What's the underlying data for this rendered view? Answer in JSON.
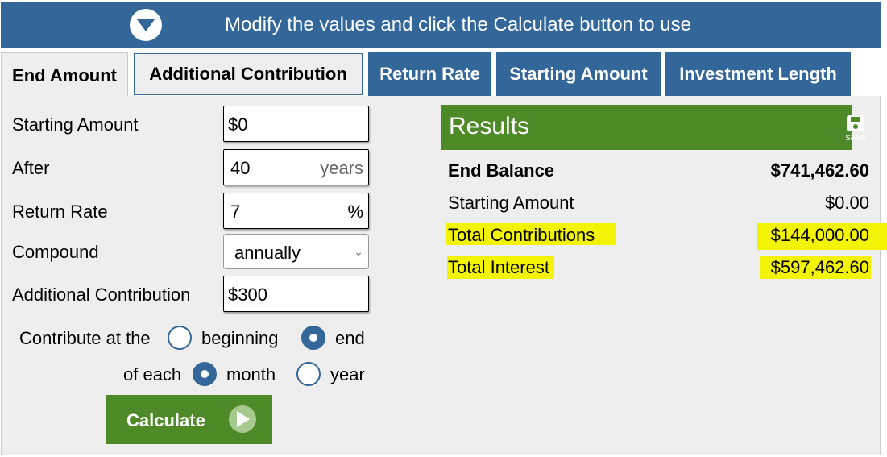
{
  "banner": {
    "text": "Modify the values and click the Calculate button to use",
    "icon": "chevron-down-circle-icon"
  },
  "tabs": [
    {
      "label": "End Amount",
      "state": "active"
    },
    {
      "label": "Additional Contribution",
      "state": "light"
    },
    {
      "label": "Return Rate",
      "state": "blue"
    },
    {
      "label": "Starting Amount",
      "state": "blue"
    },
    {
      "label": "Investment Length",
      "state": "blue"
    }
  ],
  "form": {
    "starting_amount": {
      "label": "Starting Amount",
      "value": "$0"
    },
    "after": {
      "label": "After",
      "value": "40",
      "suffix": "years"
    },
    "return_rate": {
      "label": "Return Rate",
      "value": "7",
      "suffix": "%"
    },
    "compound": {
      "label": "Compound",
      "value": "annually"
    },
    "additional_contribution": {
      "label": "Additional Contribution",
      "value": "$300"
    },
    "contribute_at": {
      "label": "Contribute at the",
      "options": [
        "beginning",
        "end"
      ],
      "selected": "end"
    },
    "of_each": {
      "label": "of each",
      "options": [
        "month",
        "year"
      ],
      "selected": "month"
    },
    "calculate_label": "Calculate"
  },
  "results": {
    "title": "Results",
    "save_label": "save",
    "rows": [
      {
        "label": "End Balance",
        "value": "$741,462.60",
        "bold": true
      },
      {
        "label": "Starting Amount",
        "value": "$0.00"
      },
      {
        "label": "Total Contributions",
        "value": "$144,000.00",
        "highlighted": true
      },
      {
        "label": "Total Interest",
        "value": "$597,462.60",
        "highlighted": true
      }
    ]
  },
  "colors": {
    "brand_blue": "#336699",
    "brand_green": "#4e8a27",
    "highlight": "#f3f306",
    "panel_bg": "#eeeeee"
  }
}
